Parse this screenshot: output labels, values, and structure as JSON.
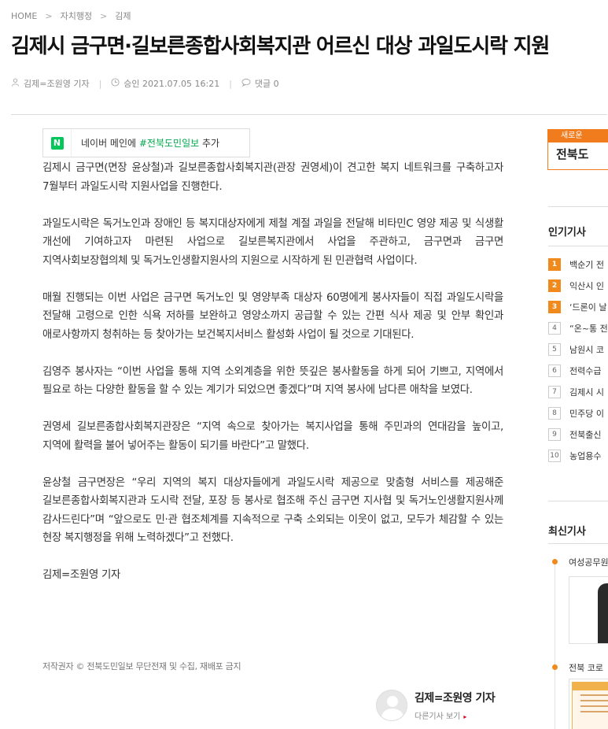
{
  "breadcrumb": {
    "home": "HOME",
    "section": "자치행정",
    "subsection": "김제",
    "sep": ">"
  },
  "article": {
    "title": "김제시 금구면·길보른종합사회복지관 어르신 대상 과일도시락 지원",
    "author_meta": "김제=조원영 기자",
    "approved": "승인 2021.07.05 16:21",
    "comments": "댓글 0",
    "paragraphs": [
      "김제시 금구면(면장 윤상철)과 길보른종합사회복지관(관장 권영세)이 견고한 복지 네트워크를 구축하고자 7월부터 과일도시락 지원사업을 진행한다.",
      "과일도시락은 독거노인과 장애인 등 복지대상자에게 제철 계절 과일을 전달해 비타민C 영양 제공 및 식생활 개선에 기여하고자 마련된 사업으로 길보른복지관에서 사업을 주관하고, 금구면과 금구면 지역사회보장협의체 및 독거노인생활지원사의 지원으로 시작하게 된 민관협력 사업이다.",
      "매월 진행되는 이번 사업은 금구면 독거노인 및 영양부족 대상자 60명에게 봉사자들이 직접 과일도시락을 전달해 고령으로 인한 식욕 저하를 보완하고 영양소까지 공급할 수 있는 간편 식사 제공 및 안부 확인과 애로사항까지 청취하는 등 찾아가는 보건복지서비스 활성화 사업이 될 것으로 기대된다.",
      "김영주 봉사자는 “이번 사업을 통해 지역 소외계층을 위한 뜻깊은 봉사활동을 하게 되어 기쁘고, 지역에서 필요로 하는 다양한 활동을 할 수 있는 계기가 되었으면 좋겠다”며 지역 봉사에 남다른 애착을 보였다.",
      "권영세 길보른종합사회복지관장은 “지역 속으로 찾아가는 복지사업을 통해 주민과의 연대감을 높이고, 지역에 활력을 불어 넣어주는 활동이 되기를 바란다”고 말했다.",
      "윤상철 금구면장은 “우리 지역의 복지 대상자들에게 과일도시락 제공으로 맞춤형 서비스를 제공해준 길보른종합사회복지관과 도시락 전달, 포장 등 봉사로 협조해 주신 금구면 지사협 및 독거노인생활지원사께 감사드린다”며 “앞으로도 민·관 협조체계를 지속적으로 구축 소외되는 이웃이 없고, 모두가 체감할 수 있는 현장 복지행정을 위해 노력하겠다”고 전했다.",
      "김제=조원영 기자"
    ],
    "copyright": "저작권자 © 전북도민일보 무단전재 및 수집, 재배포 금지"
  },
  "naver": {
    "logo": "N",
    "prefix": "네이버 메인에 ",
    "highlight": "#전북도민일보",
    "suffix": " 추가"
  },
  "reporter_box": {
    "name": "김제=조원영 기자",
    "more": "다른기사 보기",
    "arrow": "▸"
  },
  "sidebar": {
    "banner_top": "새로운",
    "banner_bottom": "전북도",
    "popular_title": "인기기사",
    "popular": [
      {
        "rank": "1",
        "text": "백순기 전"
      },
      {
        "rank": "2",
        "text": "익산시 인"
      },
      {
        "rank": "3",
        "text": "‘드론이 날"
      },
      {
        "rank": "4",
        "text": "“온~통 전"
      },
      {
        "rank": "5",
        "text": "남원시 코"
      },
      {
        "rank": "6",
        "text": "전력수급"
      },
      {
        "rank": "7",
        "text": "김제시 시"
      },
      {
        "rank": "8",
        "text": "민주당 이"
      },
      {
        "rank": "9",
        "text": "전북출신"
      },
      {
        "rank": "10",
        "text": "농업용수"
      }
    ],
    "latest_title": "최신기사",
    "latest": [
      {
        "text": "여성공무원"
      },
      {
        "text": "전북 코로"
      }
    ]
  },
  "colors": {
    "accent": "#f08a1c",
    "naver_green": "#03c75a",
    "arrow_red": "#e2001a"
  },
  "icons": {
    "author": "user-icon",
    "clock": "clock-icon",
    "comment": "comment-icon"
  }
}
